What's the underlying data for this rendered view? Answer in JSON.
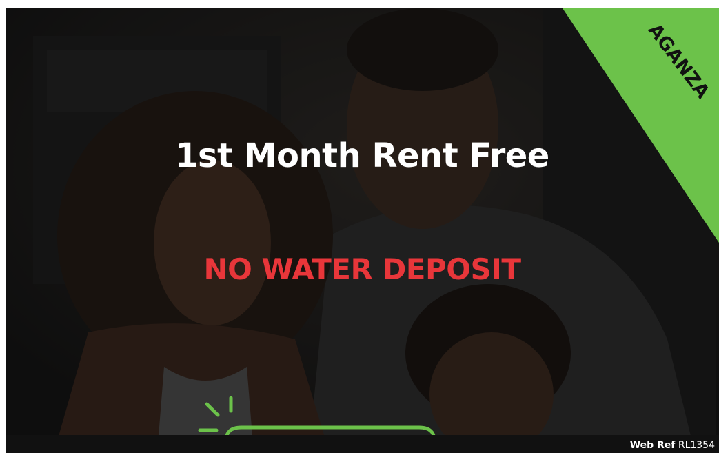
{
  "promo": {
    "headline": "1st Month Rent Free",
    "subheadline": "NO WATER DEPOSIT",
    "corner_banner_text": "AGANZA"
  },
  "footer": {
    "ref_label": "Web Ref",
    "ref_code": "RL1354"
  },
  "colors": {
    "accent_green": "#6cc24a",
    "headline_white": "#ffffff",
    "subheadline_red": "#e8363a",
    "overlay_dark": "#1b1b1b"
  }
}
